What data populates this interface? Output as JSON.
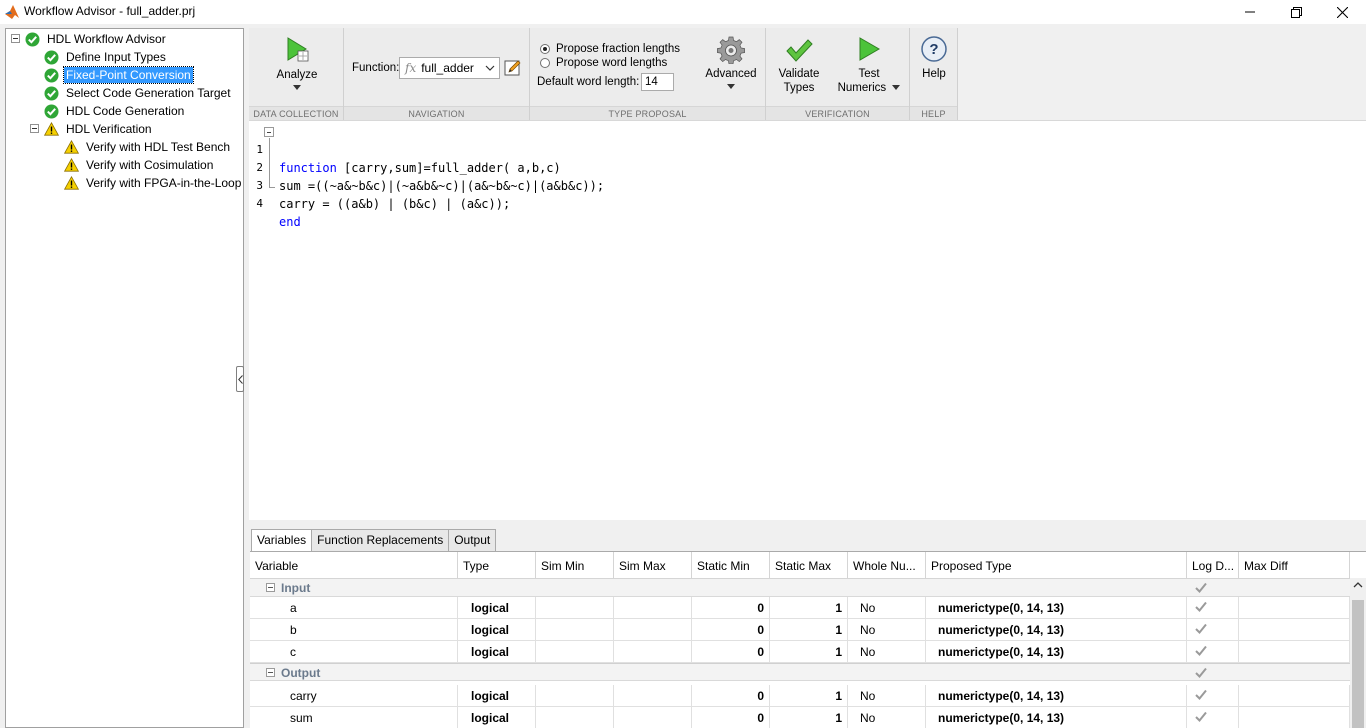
{
  "window": {
    "title": "Workflow Advisor - full_adder.prj"
  },
  "tree": {
    "root": "HDL Workflow Advisor",
    "items": [
      {
        "label": "Define Input Types",
        "status": "ok"
      },
      {
        "label": "Fixed-Point Conversion",
        "status": "ok",
        "selected": true
      },
      {
        "label": "Select Code Generation Target",
        "status": "ok"
      },
      {
        "label": "HDL Code Generation",
        "status": "ok"
      }
    ],
    "verification": {
      "label": "HDL Verification",
      "items": [
        {
          "label": "Verify with HDL Test Bench"
        },
        {
          "label": "Verify with Cosimulation"
        },
        {
          "label": "Verify with FPGA-in-the-Loop"
        }
      ]
    }
  },
  "toolstrip": {
    "sections": {
      "data_collection": "DATA COLLECTION",
      "navigation": "NAVIGATION",
      "type_proposal": "TYPE PROPOSAL",
      "verification": "VERIFICATION",
      "help": "HELP"
    },
    "analyze": "Analyze",
    "function_label": "Function:",
    "function_value": "full_adder",
    "fx": "fx",
    "propose_fraction": "Propose fraction lengths",
    "propose_word": "Propose word lengths",
    "default_word_length_label": "Default word length:",
    "default_word_length": "14",
    "advanced": "Advanced",
    "validate_1": "Validate",
    "validate_2": "Types",
    "test_1": "Test",
    "test_2": "Numerics",
    "help": "Help"
  },
  "code": {
    "lines": [
      {
        "n": "1",
        "kw": "function",
        "text": " [carry,sum]=full_adder( a,b,c)"
      },
      {
        "n": "2",
        "kw": "",
        "text": "sum =((~a&~b&c)|(~a&b&~c)|(a&~b&~c)|(a&b&c));"
      },
      {
        "n": "3",
        "kw": "",
        "text": "carry = ((a&b) | (b&c) | (a&c));"
      },
      {
        "n": "4",
        "kw": "end",
        "text": ""
      }
    ]
  },
  "tabs": [
    "Variables",
    "Function Replacements",
    "Output"
  ],
  "table": {
    "columns": [
      "Variable",
      "Type",
      "Sim Min",
      "Sim Max",
      "Static Min",
      "Static Max",
      "Whole Nu...",
      "Proposed Type",
      "Log D...",
      "Max Diff"
    ],
    "groups": [
      {
        "name": "Input",
        "rows": [
          {
            "variable": "a",
            "type": "logical",
            "static_min": "0",
            "static_max": "1",
            "whole": "No",
            "proposed": "numerictype(0, 14, 13)"
          },
          {
            "variable": "b",
            "type": "logical",
            "static_min": "0",
            "static_max": "1",
            "whole": "No",
            "proposed": "numerictype(0, 14, 13)"
          },
          {
            "variable": "c",
            "type": "logical",
            "static_min": "0",
            "static_max": "1",
            "whole": "No",
            "proposed": "numerictype(0, 14, 13)"
          }
        ]
      },
      {
        "name": "Output",
        "rows": [
          {
            "variable": "carry",
            "type": "logical",
            "static_min": "0",
            "static_max": "1",
            "whole": "No",
            "proposed": "numerictype(0, 14, 13)"
          },
          {
            "variable": "sum",
            "type": "logical",
            "static_min": "0",
            "static_max": "1",
            "whole": "No",
            "proposed": "numerictype(0, 14, 13)"
          }
        ]
      }
    ]
  },
  "colors": {
    "ok_green": "#2fa636",
    "warn_yellow": "#f5d000",
    "selection_blue": "#3399ff",
    "keyword_blue": "#0000ff",
    "play_green": "#4cc33a"
  }
}
